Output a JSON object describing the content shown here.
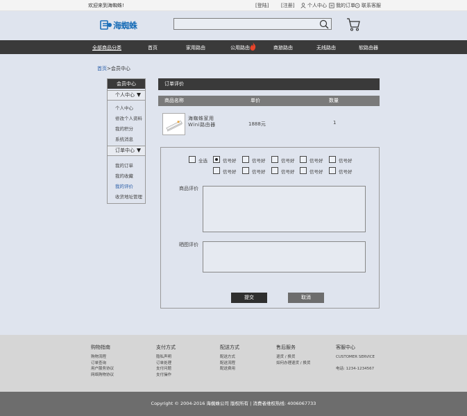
{
  "topbar": {
    "welcome": "欢迎来到海蜘蛛!",
    "login": "[登陆]",
    "register": "[注册]",
    "personal_center": "个人中心",
    "my_orders": "我的订单",
    "contact_service": "联系客服"
  },
  "header": {
    "logo_text": "海蜘蛛",
    "search_placeholder": ""
  },
  "nav": {
    "all_categories": "全部商品分类",
    "items": [
      "首页",
      "家用路由",
      "公用路由",
      "商旅路由",
      "无线路由",
      "软路由器"
    ]
  },
  "breadcrumb": {
    "home": "首页",
    "sep": ">",
    "current": "会员中心"
  },
  "sidebar": {
    "title": "会员中心",
    "sections": [
      {
        "label": "个人中心",
        "items": [
          "个人中心",
          "修改个人资料",
          "我的积分",
          "系统消息"
        ]
      },
      {
        "label": "订单中心",
        "items": [
          "我的订单",
          "我的收藏",
          "我的评价",
          "收货地址管理"
        ]
      }
    ],
    "active_item": "我的评价"
  },
  "order": {
    "title": "订单评价",
    "columns": [
      "商品名称",
      "单价",
      "数量"
    ],
    "product": {
      "name": "海蜘蛛家用Wini路由器",
      "price": "1888元",
      "quantity": "1"
    }
  },
  "review": {
    "select_all": "全选",
    "tags": [
      "信号好",
      "信号好",
      "信号好",
      "信号好",
      "信号好",
      "信号好",
      "信号好",
      "信号好",
      "信号好",
      "信号好"
    ],
    "checked_index": 0,
    "product_review_label": "商品评价",
    "photo_review_label": "晒图评价",
    "submit": "提交",
    "cancel": "取消"
  },
  "footer": {
    "columns": [
      {
        "title": "购物指南",
        "items": [
          "购物流程",
          "订单查询",
          "用户服务协议",
          "网络购物协议"
        ]
      },
      {
        "title": "支付方式",
        "items": [
          "隐私声明",
          "订单处理",
          "支付问题",
          "支付操作"
        ]
      },
      {
        "title": "配送方式",
        "items": [
          "配送方式",
          "配送流程",
          "配送费用"
        ]
      },
      {
        "title": "售后服务",
        "items": [
          "退货 / 换货",
          "如何办理退货 / 换货"
        ]
      },
      {
        "title": "客服中心",
        "items": [
          "CUSTOMER  SERVICE",
          "",
          "电话:  1234-1234567"
        ]
      }
    ],
    "copyright": "Copyright ©  2004-2016   海蜘蛛公司 版权所有   |   消费者维权热线: 4006067733"
  },
  "colors": {
    "dark_bar": "#3a3a3a",
    "link_blue": "#2a5ea8",
    "logo_blue": "#1c6fb8",
    "hot_red": "#e8452b"
  }
}
